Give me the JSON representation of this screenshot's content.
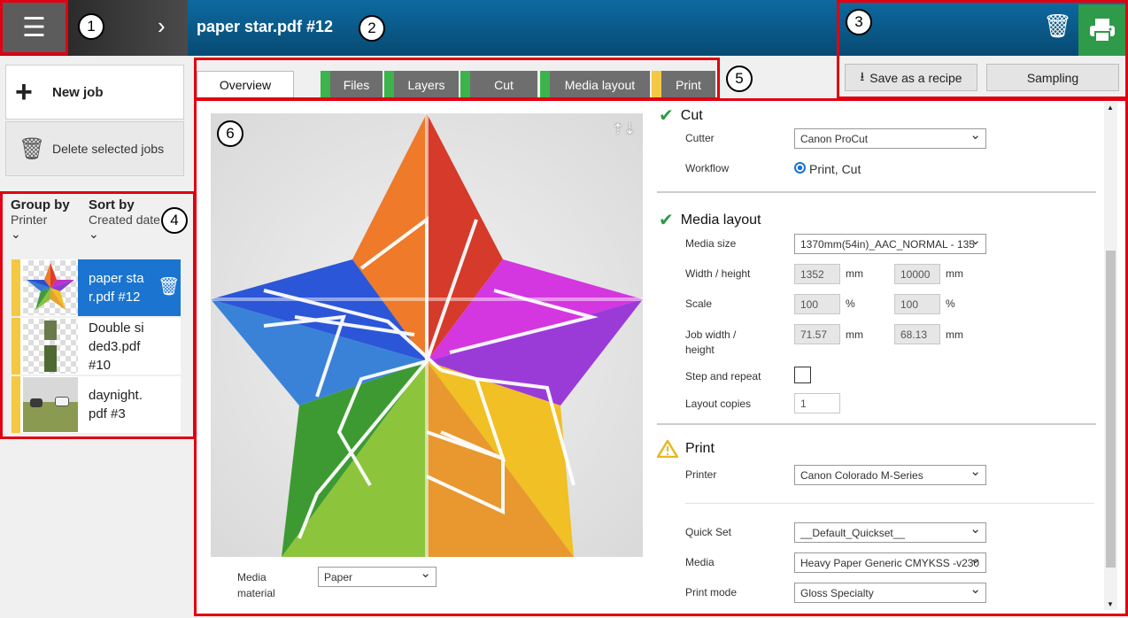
{
  "header": {
    "menu_icon": "hamburger-icon",
    "title": "paper star.pdf #12",
    "callouts": [
      "1",
      "2",
      "3",
      "4",
      "5",
      "6"
    ]
  },
  "top_actions": {
    "save_recipe": "Save as a recipe",
    "sampling": "Sampling"
  },
  "left": {
    "new_job": "New job",
    "delete_jobs": "Delete selected jobs",
    "group_by_label": "Group by",
    "group_by_value": "Printer",
    "sort_by_label": "Sort by",
    "sort_by_value": "Created date",
    "jobs": [
      {
        "name": "paper star.pdf #12",
        "status_color": "#f4c842",
        "selected": true
      },
      {
        "name": "Double sided3.pdf #10",
        "status_color": "#f4c842",
        "selected": false
      },
      {
        "name": "daynight.pdf #3",
        "status_color": "#f4c842",
        "selected": false
      }
    ]
  },
  "tabs": [
    {
      "label": "Overview",
      "status_color": ""
    },
    {
      "label": "Files",
      "status_color": "#3cb44b"
    },
    {
      "label": "Layers",
      "status_color": "#3cb44b"
    },
    {
      "label": "Cut",
      "status_color": "#3cb44b"
    },
    {
      "label": "Media layout",
      "status_color": "#3cb44b"
    },
    {
      "label": "Print",
      "status_color": "#f4c842"
    }
  ],
  "preview": {
    "media_material_label": "Media material",
    "media_material_value": "Paper"
  },
  "cut": {
    "title": "Cut",
    "cutter_label": "Cutter",
    "cutter_value": "Canon ProCut",
    "workflow_label": "Workflow",
    "workflow_value": "Print, Cut"
  },
  "media_layout": {
    "title": "Media layout",
    "media_size_label": "Media size",
    "media_size_value": "1370mm(54in)_AAC_NORMAL - 135",
    "wh_label": "Width / height",
    "width": "1352",
    "height": "10000",
    "scale_label": "Scale",
    "scale_x": "100",
    "scale_y": "100",
    "job_wh_label": "Job width / height",
    "job_width": "71.57",
    "job_height": "68.13",
    "step_repeat_label": "Step and repeat",
    "layout_copies_label": "Layout copies",
    "layout_copies": "1",
    "unit_mm": "mm",
    "unit_pct": "%"
  },
  "print": {
    "title": "Print",
    "printer_label": "Printer",
    "printer_value": "Canon Colorado M-Series",
    "quickset_label": "Quick Set",
    "quickset_value": "__Default_Quickset__",
    "media_label": "Media",
    "media_value": "Heavy Paper Generic CMYKSS -v230",
    "print_mode_label": "Print mode",
    "print_mode_value": "Gloss Specialty"
  }
}
